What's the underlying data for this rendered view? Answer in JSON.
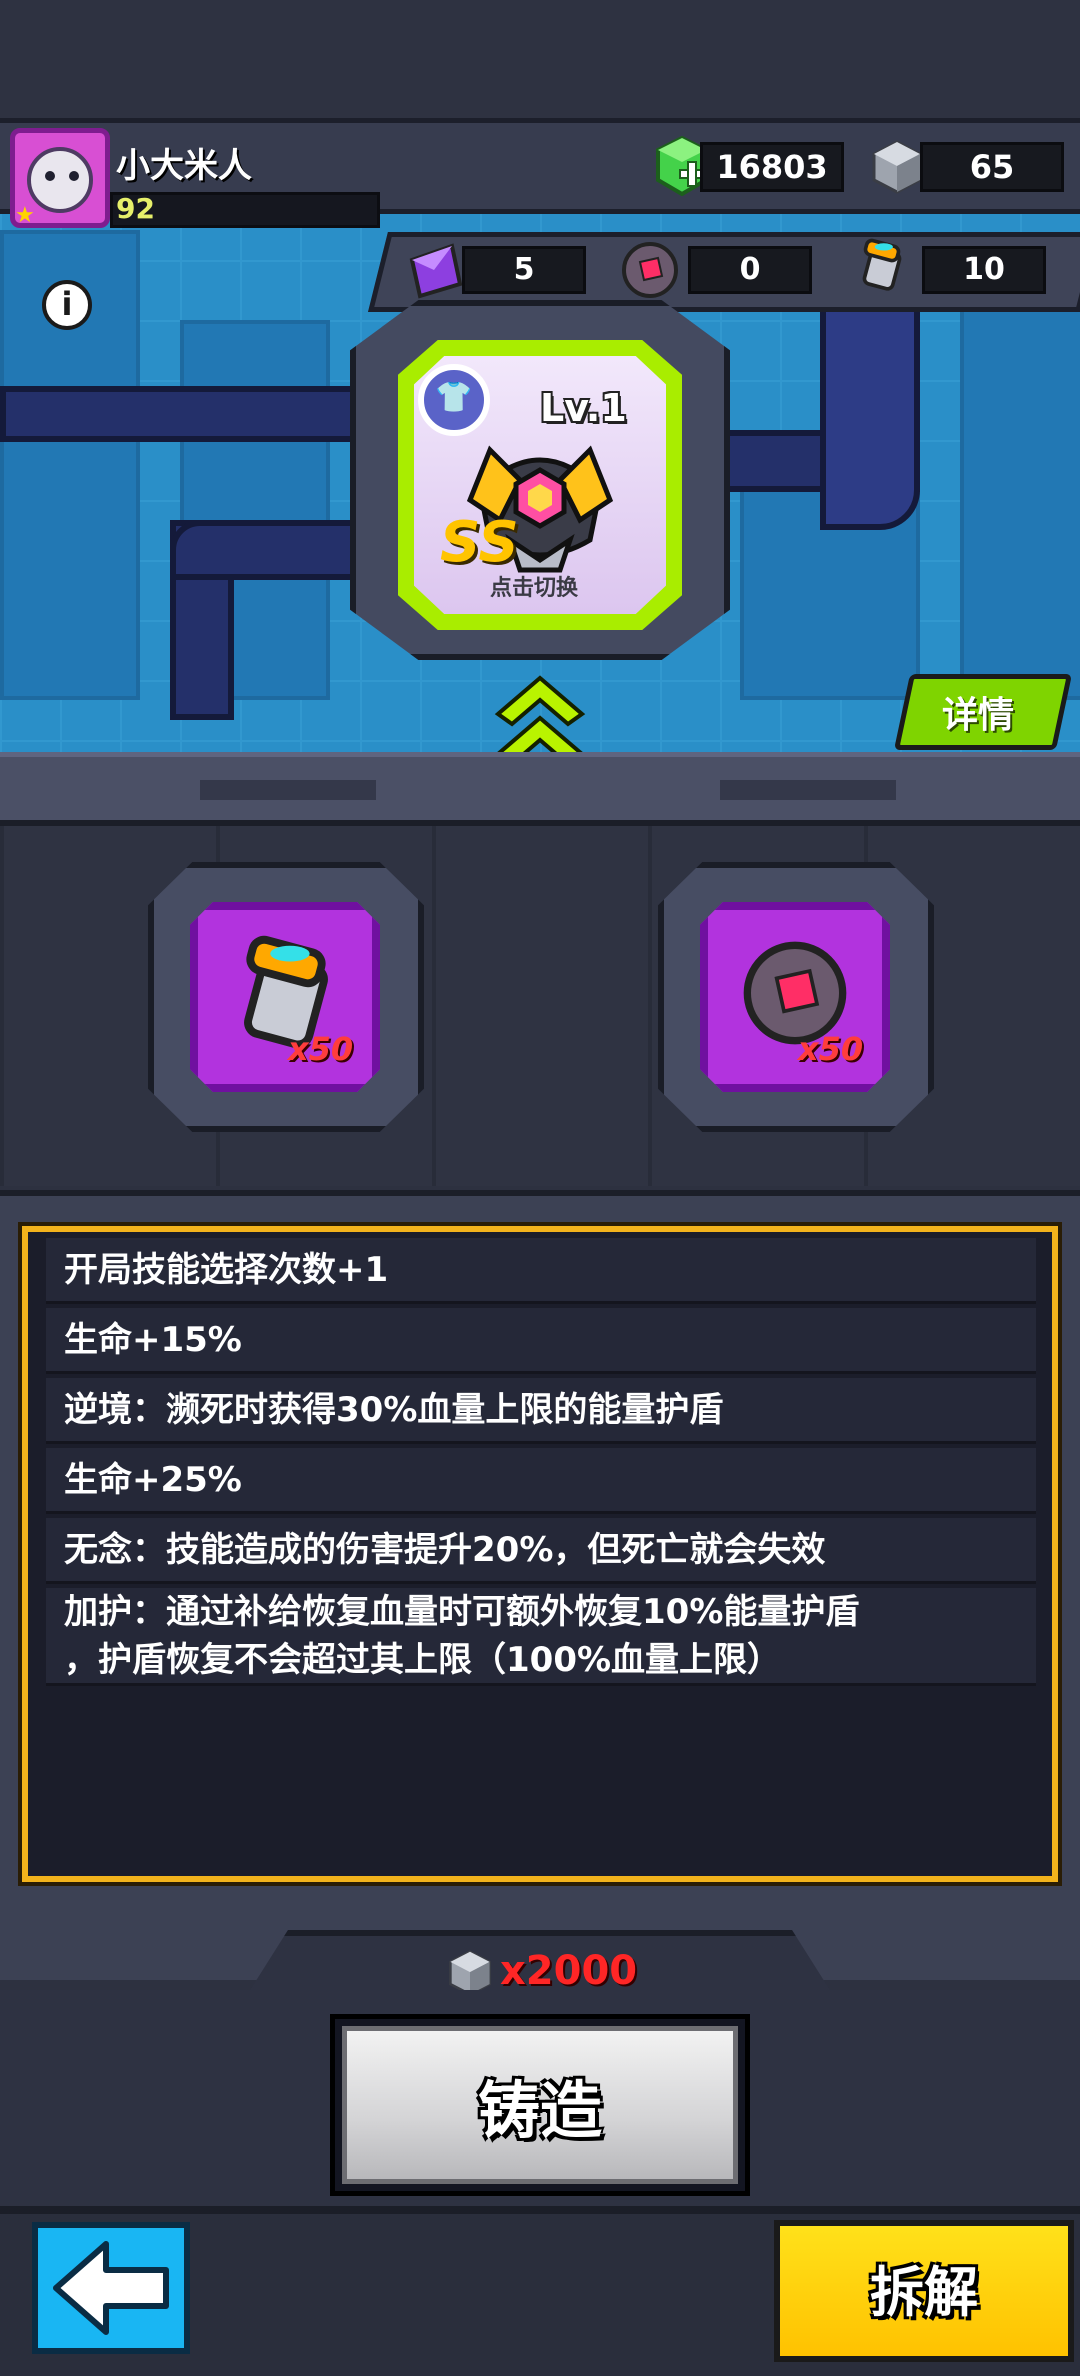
{
  "player": {
    "name": "小大米人",
    "level": "92",
    "avatar_icon": "cat-avatar-icon"
  },
  "currencies": {
    "gems": {
      "icon": "green-gem-plus-icon",
      "value": "16803"
    },
    "cubes": {
      "icon": "gray-cube-icon",
      "value": "65"
    }
  },
  "resources": [
    {
      "icon": "purple-shard-icon",
      "value": "5"
    },
    {
      "icon": "red-core-orb-icon",
      "value": "0"
    },
    {
      "icon": "orange-canister-icon",
      "value": "10"
    }
  ],
  "info_icon": "info-icon",
  "equipment": {
    "level_label": "Lv.1",
    "grade": "SS",
    "tap_hint": "点击切换",
    "slot_icon": "shirt-icon"
  },
  "detail_button": "详情",
  "materials": [
    {
      "icon": "orange-canister-icon",
      "qty": "x50"
    },
    {
      "icon": "red-core-orb-icon",
      "qty": "x50"
    }
  ],
  "stats": [
    "开局技能选择次数+1",
    "生命+15%",
    "逆境：濒死时获得30%血量上限的能量护盾",
    "生命+25%",
    "无念：技能造成的伤害提升20%，但死亡就会失效",
    "加护：通过补给恢复血量时可额外恢复10%能量护盾",
    "，护盾恢复不会超过其上限（100%血量上限）"
  ],
  "cost": {
    "icon": "gray-cube-icon",
    "label": "x2000"
  },
  "forge_button": "铸造",
  "back_button_icon": "back-arrow-icon",
  "dismantle_button": "拆解",
  "colors": {
    "accent_yellow": "#f3b31c",
    "cost_red": "#ff2626",
    "detail_green": "#7fd400",
    "back_blue": "#19b6f3"
  }
}
